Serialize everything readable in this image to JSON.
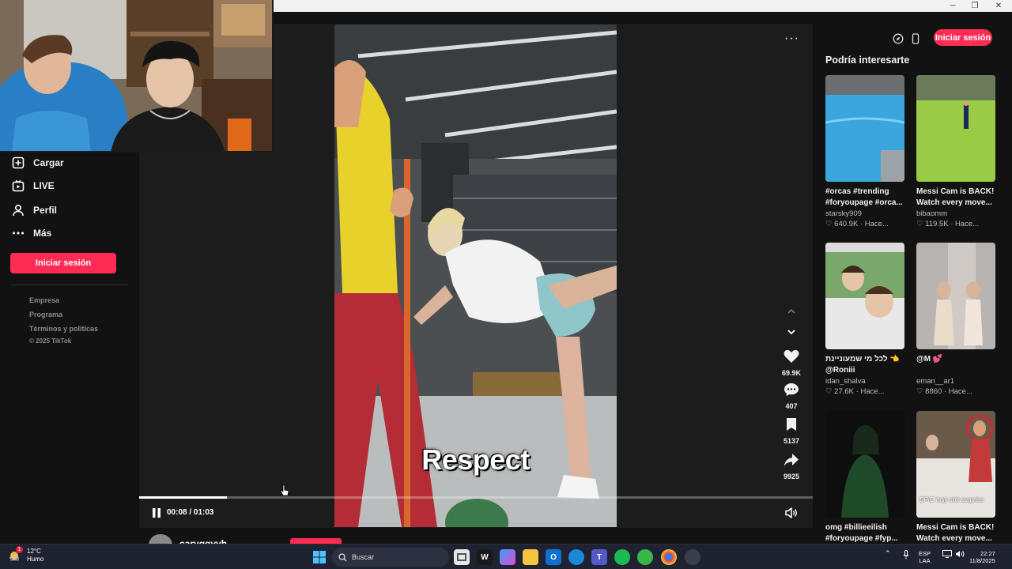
{
  "window": {
    "minimize": "─",
    "restore": "❐",
    "close": "✕"
  },
  "sidebar": {
    "items": [
      {
        "label": "Cargar",
        "icon": "upload-icon"
      },
      {
        "label": "LIVE",
        "icon": "live-icon"
      },
      {
        "label": "Perfil",
        "icon": "profile-icon"
      },
      {
        "label": "Más",
        "icon": "more-icon"
      }
    ],
    "login_label": "Iniciar sesión",
    "footer_links": [
      "Empresa",
      "Programa",
      "Términos y políticas"
    ],
    "copyright": "© 2025 TikTok"
  },
  "video": {
    "caption": "Respect",
    "more": "···",
    "actions": [
      {
        "name": "like",
        "icon": "heart-icon",
        "count": "69.9K"
      },
      {
        "name": "comment",
        "icon": "comment-icon",
        "count": "407"
      },
      {
        "name": "save",
        "icon": "bookmark-icon",
        "count": "5137"
      },
      {
        "name": "share",
        "icon": "share-icon",
        "count": "9925"
      }
    ],
    "time": "00:08 / 01:03",
    "progress": 0.13,
    "below_username": "caryggyvh"
  },
  "right_panel": {
    "login_label": "Iniciar sesión",
    "section_title": "Podría interesarte",
    "cards": [
      {
        "title": "#orcas #trending #foryoupage #orca...",
        "user": "starsky909",
        "likes": "640.9K",
        "time": "Hace..."
      },
      {
        "title": "Messi Cam is BACK! Watch every move...",
        "user": "bibaomm",
        "likes": "119.5K",
        "time": "Hace..."
      },
      {
        "title": "לכל מי שמעוניינת 👈 @Roniii",
        "user": "idan_shalva",
        "likes": "27.6K",
        "time": "Hace..."
      },
      {
        "title": "@M 💕",
        "user": "eman__ar1",
        "likes": "8860",
        "time": "Hace..."
      },
      {
        "title": "omg #billieeilish #foryoupage #fyp...",
        "user": "",
        "likes": "",
        "time": ""
      },
      {
        "title": "Messi Cam is BACK! Watch every move...",
        "user": "",
        "likes": "",
        "time": ""
      }
    ],
    "thumb_overlay_text": "EPIC holy shit surprise"
  },
  "taskbar": {
    "temp": "12°C",
    "weather": "Humo",
    "search_placeholder": "Buscar",
    "lang_line1": "ESP",
    "lang_line2": "LAA",
    "clock_time": "22:27",
    "clock_date": "11/8/2025",
    "notif_badge": "1"
  }
}
